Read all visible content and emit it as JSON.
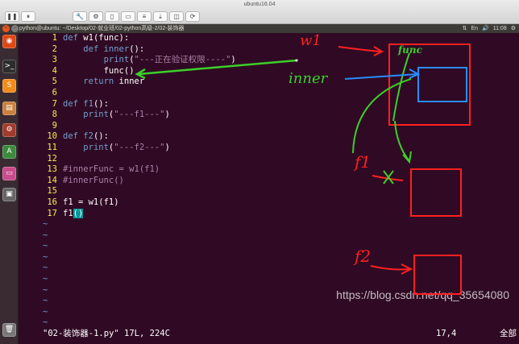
{
  "vm": {
    "title": "ubuntu16.04",
    "toolbar_buttons": [
      "❚❚",
      "⏸",
      "🔧",
      "⚙",
      "▯",
      "▭",
      "≡",
      "⤓",
      "◫",
      "⟳"
    ]
  },
  "panel": {
    "title": "python@ubuntu: ~/Desktop/02-就业班/02-python高级-2/02-装饰器",
    "time": "11:08",
    "indicators": [
      "⇅",
      "En",
      "🔊",
      "11:08",
      "⚙"
    ]
  },
  "launcher": {
    "icons": [
      "terminal-icon",
      "sublime-icon",
      "files-icon",
      "settings-icon",
      "updater-icon",
      "bar-icon",
      "disk-icon",
      "trash-icon"
    ]
  },
  "editor": {
    "lines": [
      {
        "n": "1",
        "parts": [
          [
            "kw",
            "def "
          ],
          [
            "",
            "w1(func):"
          ]
        ]
      },
      {
        "n": "2",
        "parts": [
          [
            "",
            "    "
          ],
          [
            "kw",
            "def "
          ],
          [
            "kw",
            "inner"
          ],
          [
            "",
            "():"
          ]
        ]
      },
      {
        "n": "3",
        "parts": [
          [
            "",
            "        "
          ],
          [
            "kw",
            "print"
          ],
          [
            "",
            "("
          ],
          [
            "st",
            "\"---正在验证权限----\""
          ],
          [
            "",
            ")"
          ]
        ]
      },
      {
        "n": "4",
        "parts": [
          [
            "",
            "        func("
          ],
          [
            "",
            ")"
          ]
        ]
      },
      {
        "n": "5",
        "parts": [
          [
            "",
            "    "
          ],
          [
            "kw",
            "return"
          ],
          [
            "",
            " inner"
          ]
        ]
      },
      {
        "n": "6",
        "parts": []
      },
      {
        "n": "7",
        "parts": [
          [
            "kw",
            "def "
          ],
          [
            "kw",
            "f1"
          ],
          [
            "",
            "():"
          ]
        ]
      },
      {
        "n": "8",
        "parts": [
          [
            "",
            "    "
          ],
          [
            "kw",
            "print"
          ],
          [
            "",
            "("
          ],
          [
            "st",
            "\"---f1---\""
          ],
          [
            "",
            ")"
          ]
        ]
      },
      {
        "n": "9",
        "parts": []
      },
      {
        "n": "10",
        "parts": [
          [
            "kw",
            "def "
          ],
          [
            "kw",
            "f2"
          ],
          [
            "",
            "():"
          ]
        ]
      },
      {
        "n": "11",
        "parts": [
          [
            "",
            "    "
          ],
          [
            "kw",
            "print"
          ],
          [
            "",
            "("
          ],
          [
            "st",
            "\"---f2---\""
          ],
          [
            "",
            ")"
          ]
        ]
      },
      {
        "n": "12",
        "parts": []
      },
      {
        "n": "13",
        "parts": [
          [
            "cm",
            "#innerFunc = w1(f1)"
          ]
        ]
      },
      {
        "n": "14",
        "parts": [
          [
            "cm",
            "#innerFunc()"
          ]
        ]
      },
      {
        "n": "15",
        "parts": []
      },
      {
        "n": "16",
        "parts": [
          [
            "",
            "f1 = w1(f1)"
          ]
        ]
      },
      {
        "n": "17",
        "parts": [
          [
            "",
            "f1"
          ],
          [
            "cursor",
            "()"
          ]
        ]
      }
    ],
    "tilde": "~",
    "tilde_count": 10
  },
  "status": {
    "file_info": "\"02-装饰器-1.py\" 17L, 224C",
    "position": "17,4",
    "scroll": "全部"
  },
  "watermark": "https://blog.csdn.net/qq_35654080",
  "annotations": {
    "w1_label": "w1",
    "inner_label": "inner",
    "func_label": "func",
    "f1_label": "f1",
    "f2_label": "f2"
  },
  "colors": {
    "terminal_bg": "#300a24",
    "keyword": "#729fcf",
    "string": "#ad7fa8",
    "line_number": "#fce94f",
    "annotation_red": "#ff2020",
    "annotation_green": "#3ccf2a",
    "annotation_blue": "#2a8cff"
  }
}
